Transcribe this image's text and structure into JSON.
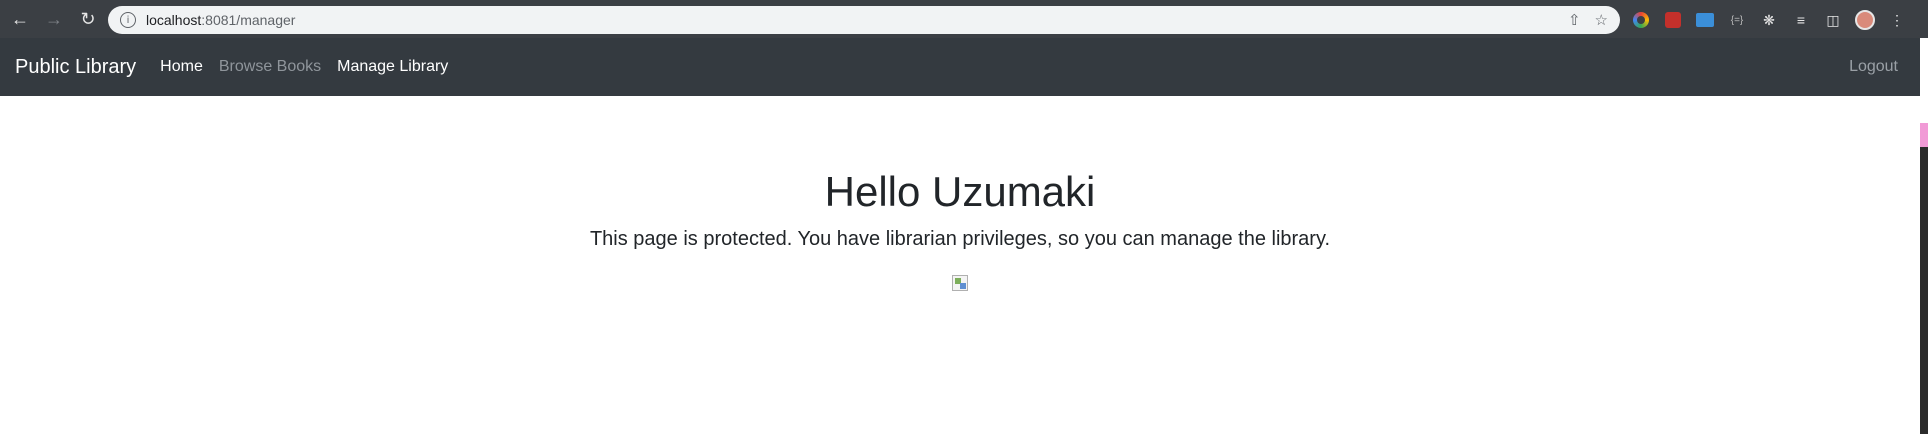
{
  "browser": {
    "url_host": "localhost",
    "url_path": ":8081/manager",
    "icons": [
      "back-icon",
      "forward-icon",
      "reload-icon",
      "info-icon",
      "share-icon",
      "star-icon",
      "extensions-icon",
      "reading-list-icon",
      "side-panel-icon",
      "profile-avatar",
      "menu-icon"
    ]
  },
  "navbar": {
    "brand": "Public Library",
    "links": [
      {
        "label": "Home",
        "active": true
      },
      {
        "label": "Browse Books",
        "active": false
      },
      {
        "label": "Manage Library",
        "active": true
      }
    ],
    "logout": "Logout",
    "background": "#343a40"
  },
  "main": {
    "title": "Hello Uzumaki",
    "message": "This page is protected. You have librarian privileges, so you can manage the library."
  }
}
